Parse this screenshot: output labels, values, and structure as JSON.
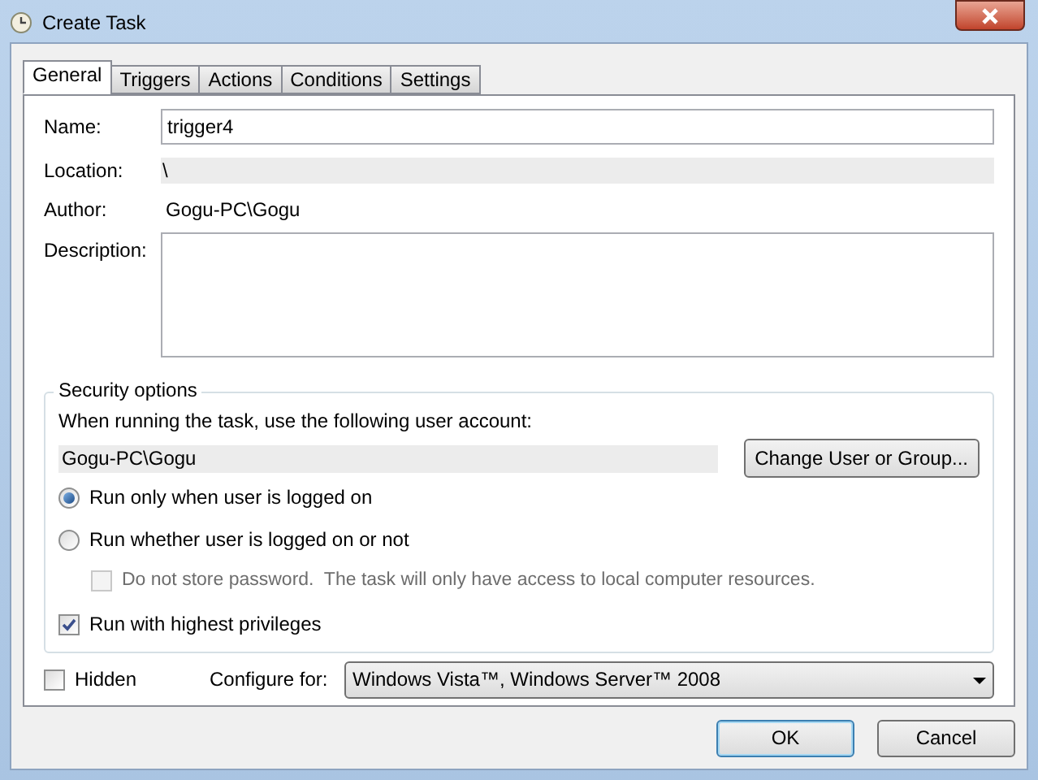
{
  "window": {
    "title": "Create Task"
  },
  "tabs": [
    {
      "label": "General",
      "selected": true
    },
    {
      "label": "Triggers",
      "selected": false
    },
    {
      "label": "Actions",
      "selected": false
    },
    {
      "label": "Conditions",
      "selected": false
    },
    {
      "label": "Settings",
      "selected": false
    }
  ],
  "general": {
    "name": {
      "label": "Name:",
      "value": "trigger4"
    },
    "location": {
      "label": "Location:",
      "value": "\\"
    },
    "author": {
      "label": "Author:",
      "value": "Gogu-PC\\Gogu"
    },
    "description": {
      "label": "Description:"
    }
  },
  "security": {
    "title": "Security options",
    "prompt": "When running the task, use the following user account:",
    "account": "Gogu-PC\\Gogu",
    "change_button": "Change User or Group...",
    "run_modes": [
      {
        "label": "Run only when user is logged on",
        "selected": true
      },
      {
        "label": "Run whether user is logged on or not",
        "selected": false
      }
    ],
    "do_not_store_password": {
      "label": "Do not store password.  The task will only have access to local computer resources.",
      "checked": false,
      "disabled": true
    },
    "highest_privileges": {
      "label": "Run with highest privileges",
      "checked": true
    }
  },
  "hidden": {
    "label": "Hidden",
    "checked": false
  },
  "configure_for": {
    "label": "Configure for:",
    "value": "Windows Vista™, Windows Server™ 2008"
  },
  "buttons": [
    {
      "label": "OK",
      "default": true
    },
    {
      "label": "Cancel",
      "default": false
    }
  ]
}
